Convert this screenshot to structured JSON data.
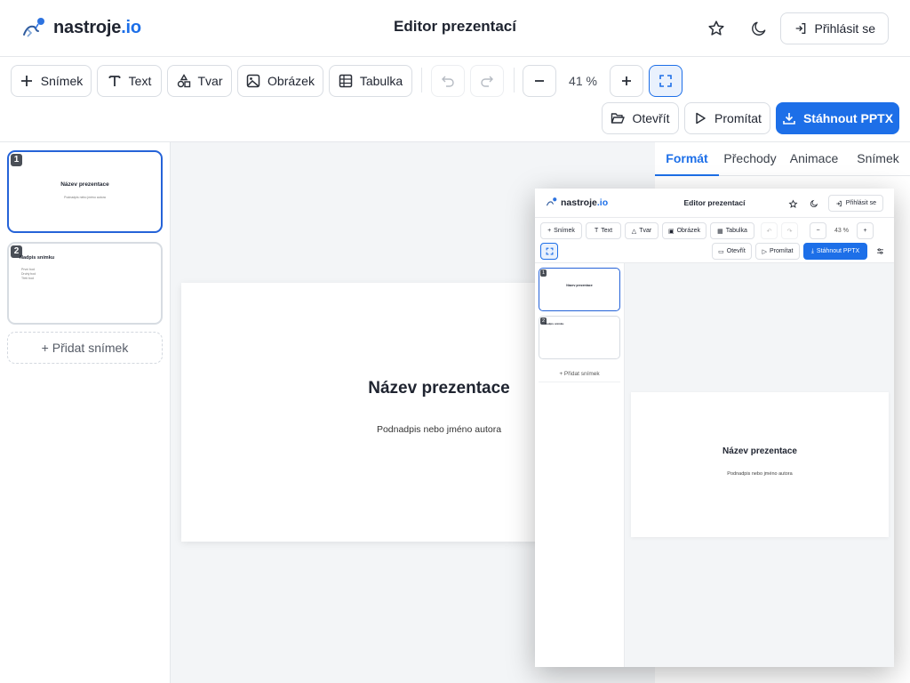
{
  "header": {
    "logo_main": "nastroje",
    "logo_tld": ".io",
    "title": "Editor prezentací",
    "login_label": "Přihlásit se",
    "icons": [
      "star-icon",
      "moon-icon",
      "login-icon"
    ]
  },
  "toolbar": {
    "add_slide": "Snímek",
    "text": "Text",
    "shape": "Tvar",
    "image": "Obrázek",
    "table": "Tabulka",
    "zoom": "41 %",
    "open": "Otevřít",
    "present": "Promítat",
    "download": "Stáhnout PPTX"
  },
  "slides": [
    {
      "num": "1",
      "title": "Název prezentace",
      "subtitle": "Podnadpis nebo jméno autora"
    },
    {
      "num": "2",
      "title": "Nadpis snímku",
      "bullets": [
        "První bod",
        "Druhý bod",
        "Třetí bod"
      ]
    }
  ],
  "sidebar": {
    "add_label": "+ Přidat snímek"
  },
  "canvas": {
    "title": "Název prezentace",
    "subtitle": "Podnadpis nebo jméno autora"
  },
  "right_panel": {
    "tabs": [
      "Formát",
      "Přechody",
      "Animace",
      "Snímek"
    ],
    "active_tab": "Formát"
  },
  "preview": {
    "logo_main": "nastroje",
    "logo_tld": ".io",
    "title": "Editor prezentací",
    "login_label": "Přihlásit se",
    "add_slide": "Snímek",
    "text": "Text",
    "shape": "Tvar",
    "image": "Obrázek",
    "table": "Tabulka",
    "zoom": "43 %",
    "open": "Otevřít",
    "present": "Promítat",
    "download": "Stáhnout PPTX",
    "add_label": "+ Přidat snímek",
    "slide_title": "Název prezentace",
    "slide_subtitle": "Podnadpis nebo jméno autora",
    "thumb1_title": "Název prezentace",
    "thumb2_title": "Nadpis snímku"
  },
  "colors": {
    "accent": "#1d6fe8",
    "canvas_bg": "#f3f5f7",
    "border": "#e5e7eb"
  }
}
